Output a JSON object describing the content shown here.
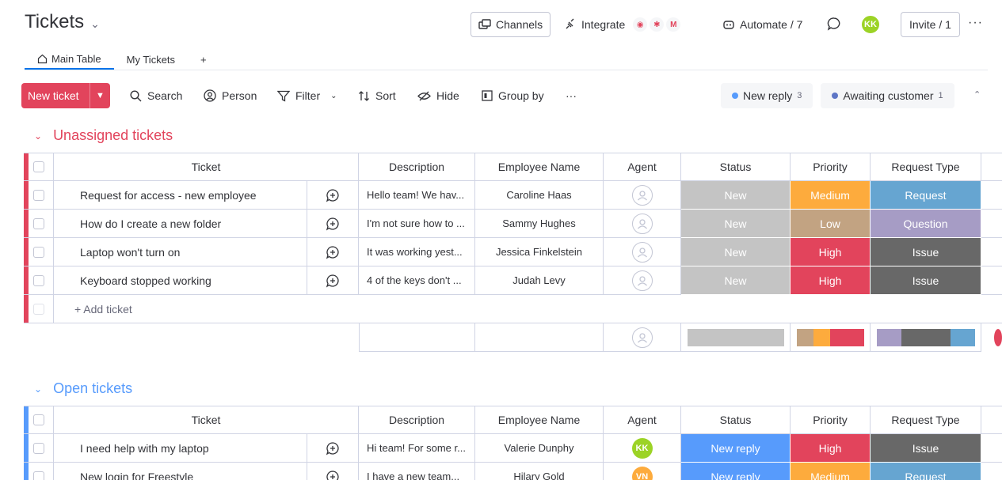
{
  "header": {
    "title": "Tickets",
    "channels": "Channels",
    "integrate": "Integrate",
    "automate": "Automate / 7",
    "user_initials": "KK",
    "invite": "Invite / 1",
    "more": "···"
  },
  "tabs": [
    {
      "label": "Main Table"
    },
    {
      "label": "My Tickets"
    },
    {
      "label": "+"
    }
  ],
  "toolbar": {
    "new_ticket": "New ticket",
    "search": "Search",
    "person": "Person",
    "filter": "Filter",
    "sort": "Sort",
    "hide": "Hide",
    "group_by": "Group by",
    "more": "···"
  },
  "filters": [
    {
      "label": "New reply",
      "count": "3",
      "color": "#579bfc"
    },
    {
      "label": "Awaiting customer",
      "count": "1",
      "color": "#5e76c6"
    }
  ],
  "columns": [
    "Ticket",
    "Description",
    "Employee Name",
    "Agent",
    "Status",
    "Priority",
    "Request Type"
  ],
  "colors": {
    "new": "#c4c4c4",
    "new_reply": "#579bfc",
    "medium": "#fdab3d",
    "low": "#c2a382",
    "high": "#e2445c",
    "request": "#66a5d1",
    "question": "#a69cc5",
    "issue": "#686868",
    "unassigned": "#e2445c",
    "open": "#579bfc"
  },
  "groups": [
    {
      "title": "Unassigned tickets",
      "add_label": "+ Add ticket",
      "rows": [
        {
          "ticket": "Request for access - new employee",
          "description": "Hello team! We hav...",
          "employee": "Caroline Haas",
          "status": "New",
          "priority": "Medium",
          "type": "Request"
        },
        {
          "ticket": "How do I create a new folder",
          "description": "I'm not sure how to ...",
          "employee": "Sammy Hughes",
          "status": "New",
          "priority": "Low",
          "type": "Question"
        },
        {
          "ticket": "Laptop won't turn on",
          "description": "It was working yest...",
          "employee": "Jessica Finkelstein",
          "status": "New",
          "priority": "High",
          "type": "Issue"
        },
        {
          "ticket": "Keyboard stopped working",
          "description": "4 of the keys don't ...",
          "employee": "Judah Levy",
          "status": "New",
          "priority": "High",
          "type": "Issue"
        }
      ]
    },
    {
      "title": "Open tickets",
      "rows": [
        {
          "ticket": "I need help with my laptop",
          "description": "Hi team! For some r...",
          "employee": "Valerie Dunphy",
          "agent": "KK",
          "agent_color": "#9cd326",
          "status": "New reply",
          "priority": "High",
          "type": "Issue"
        },
        {
          "ticket": "New login for Freestyle",
          "description": "I have a new team...",
          "employee": "Hilary Gold",
          "agent": "VN",
          "agent_color": "#fdab3d",
          "status": "New reply",
          "priority": "Medium",
          "type": "Request"
        }
      ]
    }
  ]
}
